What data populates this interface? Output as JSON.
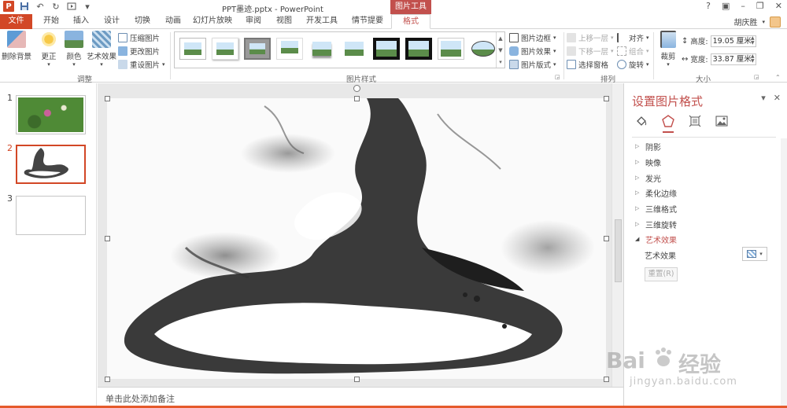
{
  "app": {
    "title": "PPT墨迹.pptx - PowerPoint",
    "contextual_tab_header": "图片工具",
    "user_name": "胡庆胜"
  },
  "tabs": [
    {
      "label": "文件"
    },
    {
      "label": "开始"
    },
    {
      "label": "插入"
    },
    {
      "label": "设计"
    },
    {
      "label": "切换"
    },
    {
      "label": "动画"
    },
    {
      "label": "幻灯片放映"
    },
    {
      "label": "审阅"
    },
    {
      "label": "视图"
    },
    {
      "label": "开发工具"
    },
    {
      "label": "情节提要"
    },
    {
      "label": "格式"
    }
  ],
  "ribbon": {
    "adjust": {
      "remove_bg": "删除背景",
      "correct": "更正",
      "color": "颜色",
      "art_effects": "艺术效果",
      "compress": "压缩图片",
      "change": "更改图片",
      "reset": "重设图片",
      "group_label": "调整"
    },
    "styles": {
      "group_label": "图片样式",
      "border": "图片边框",
      "effects": "图片效果",
      "layout": "图片版式"
    },
    "arrange": {
      "bring_forward": "上移一层",
      "send_backward": "下移一层",
      "selection_pane": "选择窗格",
      "align": "对齐",
      "group": "组合",
      "rotate": "旋转",
      "group_label": "排列"
    },
    "size": {
      "crop": "裁剪",
      "height_label": "高度:",
      "height_value": "19.05 厘米",
      "width_label": "宽度:",
      "width_value": "33.87 厘米",
      "group_label": "大小"
    }
  },
  "slides": [
    {
      "number": "1"
    },
    {
      "number": "2"
    },
    {
      "number": "3"
    }
  ],
  "notes_placeholder": "单击此处添加备注",
  "format_pane": {
    "title": "设置图片格式",
    "sections": [
      {
        "label": "阴影"
      },
      {
        "label": "映像"
      },
      {
        "label": "发光"
      },
      {
        "label": "柔化边缘"
      },
      {
        "label": "三维格式"
      },
      {
        "label": "三维旋转"
      },
      {
        "label": "艺术效果"
      }
    ],
    "art_effect_label": "艺术效果",
    "reset_label": "重置(R)"
  },
  "watermark": {
    "brand": "Bai",
    "brand_cn": "经验",
    "url": "jingyan.baidu.com"
  },
  "colors": {
    "accent": "#d24726",
    "contextual": "#c2504d"
  }
}
